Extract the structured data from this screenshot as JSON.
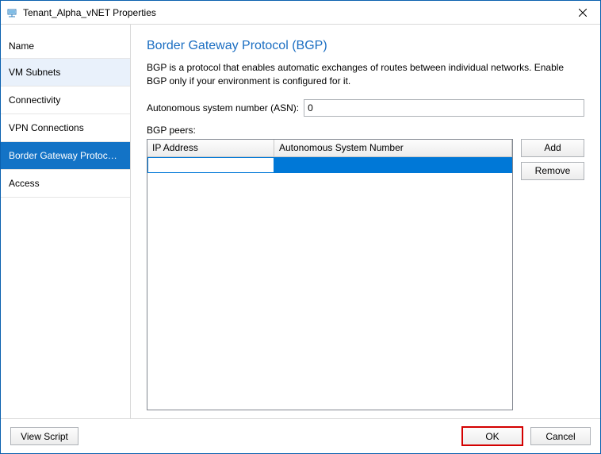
{
  "window": {
    "title": "Tenant_Alpha_vNET Properties"
  },
  "sidebar": {
    "header": "Name",
    "items": [
      {
        "label": "VM Subnets"
      },
      {
        "label": "Connectivity"
      },
      {
        "label": "VPN Connections"
      },
      {
        "label": "Border Gateway Protocol..."
      },
      {
        "label": "Access"
      }
    ]
  },
  "main": {
    "title": "Border Gateway Protocol (BGP)",
    "description": "BGP is a protocol that enables automatic exchanges of routes between individual networks. Enable BGP only if your environment is configured for it.",
    "asn_label": "Autonomous system number (ASN):",
    "asn_value": "0",
    "peers_label": "BGP peers:",
    "columns": {
      "ip": "IP Address",
      "asn": "Autonomous System Number"
    },
    "peers": [
      {
        "ip": "",
        "asn": ""
      }
    ],
    "buttons": {
      "add": "Add",
      "remove": "Remove"
    }
  },
  "footer": {
    "view_script": "View Script",
    "ok": "OK",
    "cancel": "Cancel"
  }
}
